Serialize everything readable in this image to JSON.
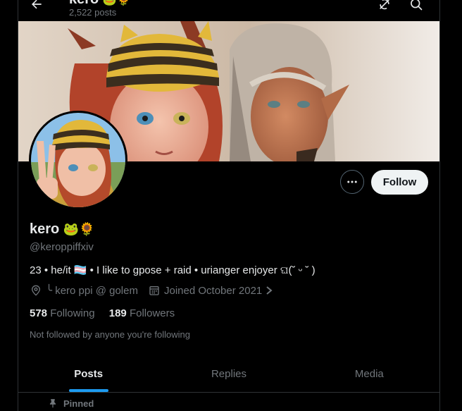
{
  "header": {
    "title": "kero",
    "title_emoji": "🐸🌻",
    "posts_count": "2,522 posts"
  },
  "icons": {
    "back": "arrow-left-icon",
    "grok": "grok-icon",
    "search": "search-icon",
    "more": "more-dots-icon",
    "location": "location-pin-icon",
    "calendar": "calendar-icon",
    "pin": "pin-icon"
  },
  "profile": {
    "display_name": "kero",
    "name_emoji": "🐸🌻",
    "handle": "@keroppiffxiv",
    "bio": "23 • he/it 🏳️‍⚧️ • I like to gpose + raid • urianger enjoyer ଘ(˘ ᵕ ˘ )",
    "location": "╰ kero ppi @ golem",
    "joined": "Joined October 2021",
    "following_count": "578",
    "following_label": "Following",
    "followers_count": "189",
    "followers_label": "Followers",
    "not_followed": "Not followed by anyone you're following"
  },
  "actions": {
    "follow_label": "Follow"
  },
  "tabs": [
    {
      "label": "Posts",
      "active": true
    },
    {
      "label": "Replies",
      "active": false
    },
    {
      "label": "Media",
      "active": false
    }
  ],
  "pinned_label": "Pinned",
  "colors": {
    "background": "#000000",
    "text_primary": "#e7e9ea",
    "text_secondary": "#71767b",
    "accent": "#1d9bf0",
    "follow_bg": "#eff3f4",
    "border": "#2f3336"
  }
}
